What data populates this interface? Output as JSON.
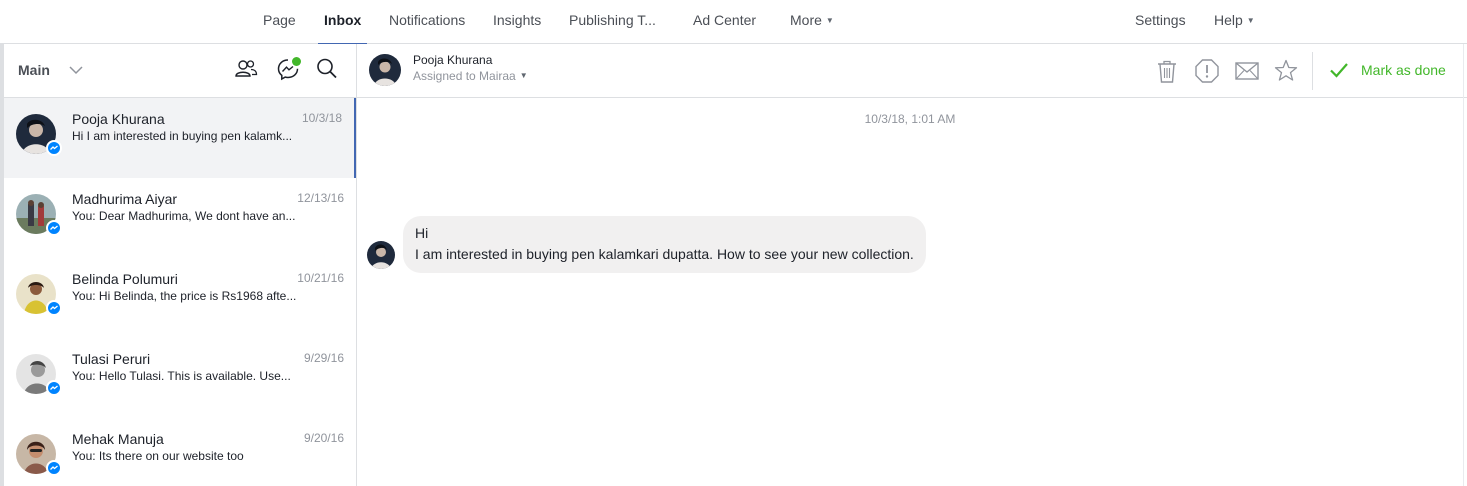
{
  "nav": {
    "items": [
      {
        "label": "Page",
        "active": false
      },
      {
        "label": "Inbox",
        "active": true
      },
      {
        "label": "Notifications",
        "active": false
      },
      {
        "label": "Insights",
        "active": false
      },
      {
        "label": "Publishing T...",
        "active": false
      },
      {
        "label": "Ad Center",
        "active": false
      },
      {
        "label": "More",
        "active": false
      }
    ],
    "right_items": [
      {
        "label": "Settings"
      },
      {
        "label": "Help"
      }
    ]
  },
  "sidebar": {
    "folder": "Main",
    "icons": [
      "people-icon",
      "messenger-status-icon",
      "search-icon"
    ],
    "conversations": [
      {
        "name": "Pooja Khurana",
        "date": "10/3/18",
        "snippet": "Hi I am interested in buying pen kalamk...",
        "selected": true,
        "avatar_color": "#1f2a3c"
      },
      {
        "name": "Madhurima Aiyar",
        "date": "12/13/16",
        "snippet": "You: Dear Madhurima, We dont have an...",
        "selected": false,
        "avatar_color": "#6b7b5e"
      },
      {
        "name": "Belinda Polumuri",
        "date": "10/21/16",
        "snippet": "You: Hi Belinda, the price is Rs1968 afte...",
        "selected": false,
        "avatar_color": "#c9b13a"
      },
      {
        "name": "Tulasi Peruri",
        "date": "9/29/16",
        "snippet": "You: Hello Tulasi. This is available. Use...",
        "selected": false,
        "avatar_color": "#b9b9b9"
      },
      {
        "name": "Mehak Manuja",
        "date": "9/20/16",
        "snippet": "You: Its there on our website too",
        "selected": false,
        "avatar_color": "#8a5a4a"
      }
    ]
  },
  "conversation": {
    "contact_name": "Pooja Khurana",
    "assigned_text": "Assigned to Mairaa",
    "timestamp": "10/3/18, 1:01 AM",
    "message_lines": [
      "Hi",
      "I am interested in buying pen kalamkari dupatta. How to see your new collection."
    ],
    "toolbar_icons": [
      "trash-icon",
      "report-spam-icon",
      "mark-unread-icon",
      "star-icon"
    ],
    "done_label": "Mark as done"
  },
  "colors": {
    "accent": "#4267b2",
    "done_green": "#42b72a",
    "messenger_blue": "#0084ff",
    "bubble_bg": "#f1f0f0"
  }
}
